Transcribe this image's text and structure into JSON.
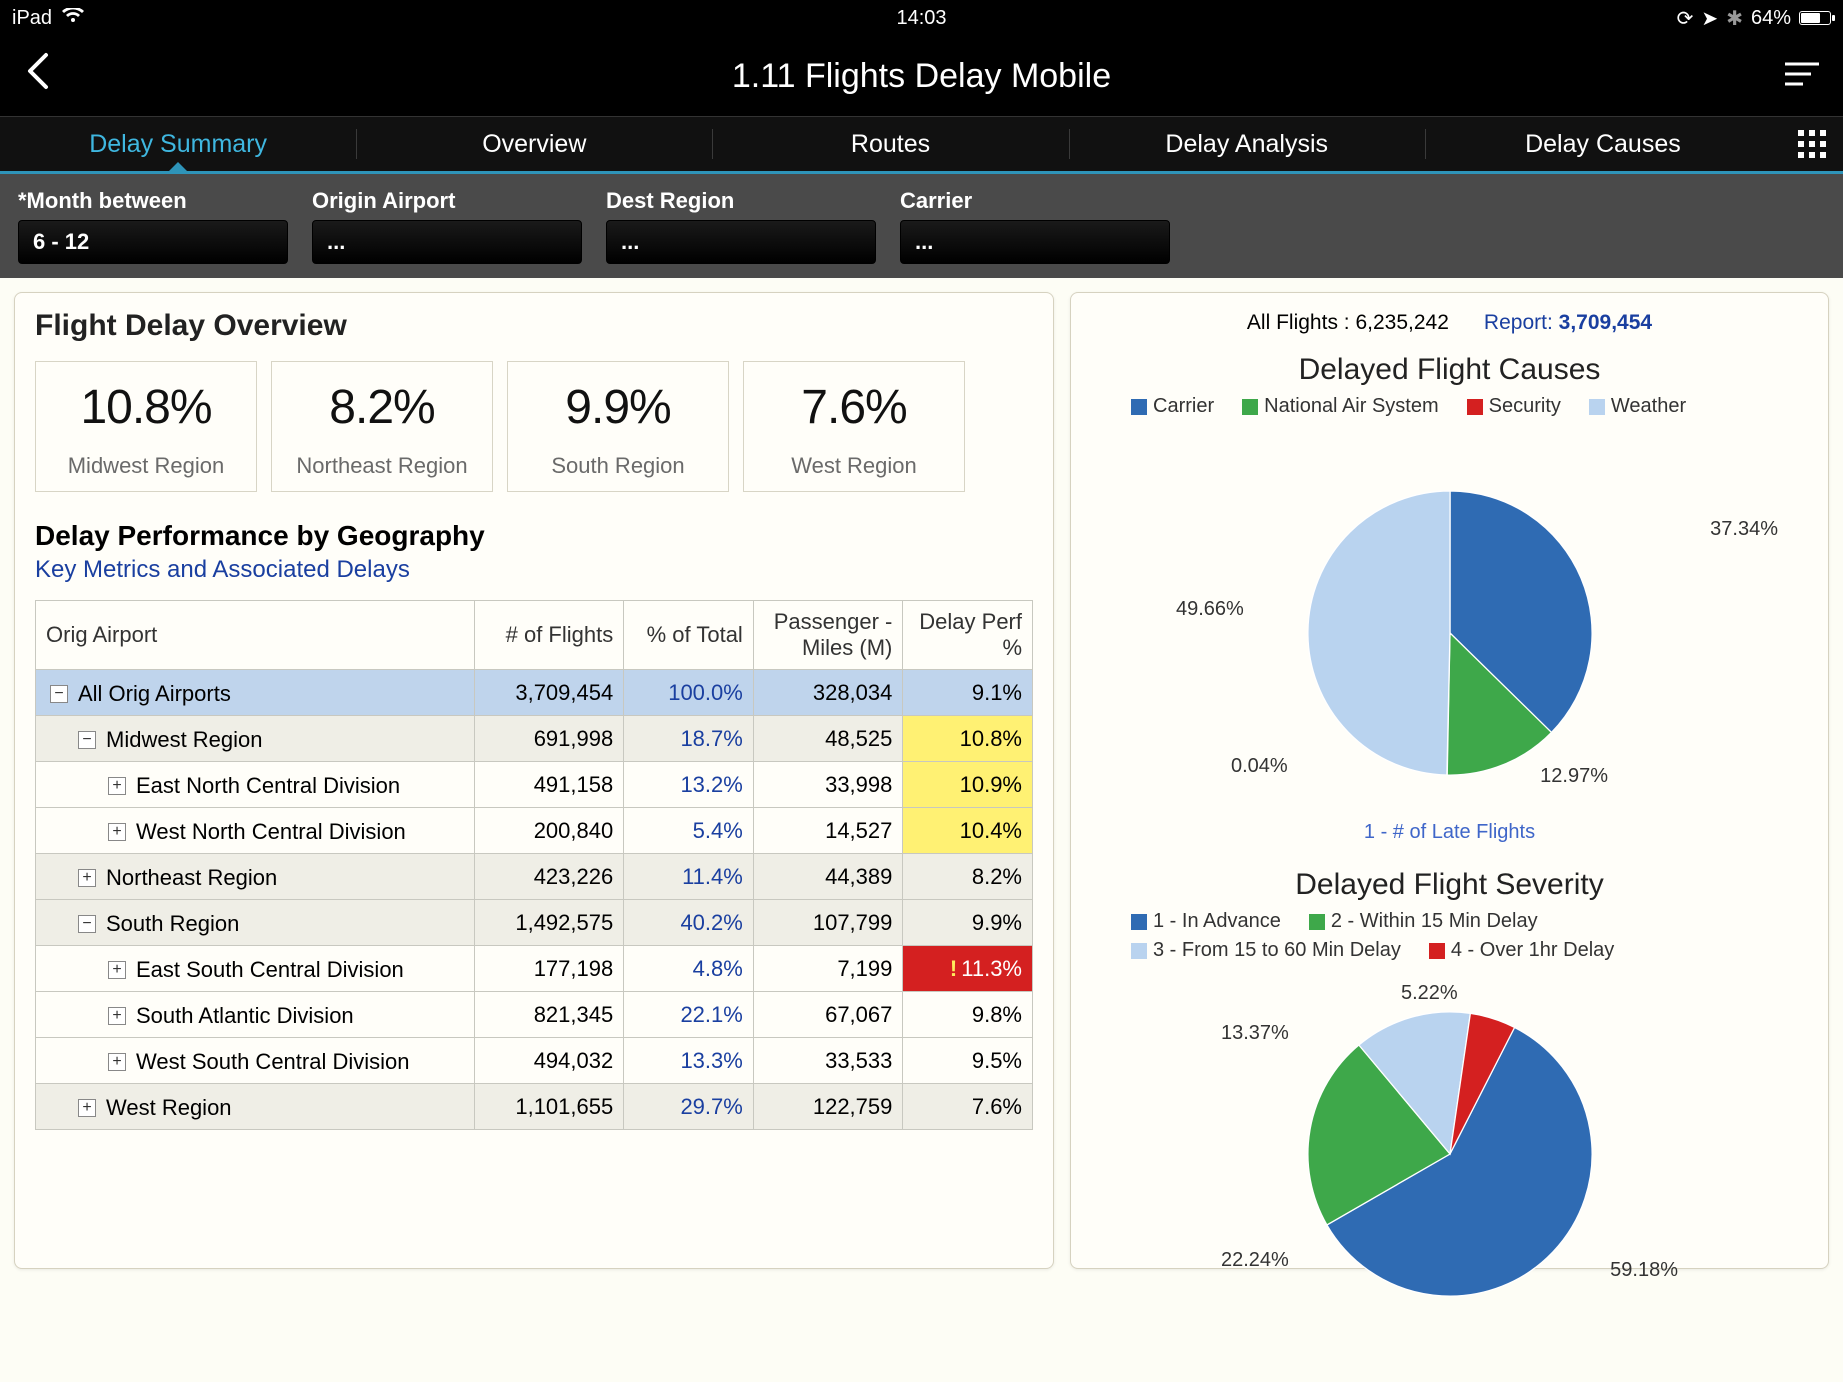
{
  "status": {
    "device": "iPad",
    "time": "14:03",
    "battery": "64%"
  },
  "nav": {
    "title": "1.11 Flights Delay Mobile"
  },
  "tabs": [
    "Delay Summary",
    "Overview",
    "Routes",
    "Delay Analysis",
    "Delay Causes"
  ],
  "active_tab": 0,
  "filters": [
    {
      "label": "*Month between",
      "value": "6 - 12"
    },
    {
      "label": "Origin Airport",
      "value": "..."
    },
    {
      "label": "Dest Region",
      "value": "..."
    },
    {
      "label": "Carrier",
      "value": "..."
    }
  ],
  "overview": {
    "title": "Flight Delay Overview",
    "kpis": [
      {
        "value": "10.8%",
        "label": "Midwest Region"
      },
      {
        "value": "8.2%",
        "label": "Northeast Region"
      },
      {
        "value": "9.9%",
        "label": "South Region"
      },
      {
        "value": "7.6%",
        "label": "West Region"
      }
    ]
  },
  "geo": {
    "title": "Delay Performance by Geography",
    "subtitle": "Key Metrics and Associated Delays",
    "headers": [
      "Orig Airport",
      "# of Flights",
      "% of Total",
      "Passenger - Miles (M)",
      "Delay Perf %"
    ],
    "rows": [
      {
        "lvl": 0,
        "exp": "minus",
        "name": "All Orig Airports",
        "flights": "3,709,454",
        "pct": "100.0%",
        "pm": "328,034",
        "perf": "9.1%",
        "hl": ""
      },
      {
        "lvl": 1,
        "exp": "minus",
        "name": "Midwest Region",
        "flights": "691,998",
        "pct": "18.7%",
        "pm": "48,525",
        "perf": "10.8%",
        "hl": "yellow"
      },
      {
        "lvl": 2,
        "exp": "plus",
        "name": "East North Central Division",
        "flights": "491,158",
        "pct": "13.2%",
        "pm": "33,998",
        "perf": "10.9%",
        "hl": "yellow"
      },
      {
        "lvl": 2,
        "exp": "plus",
        "name": "West North Central Division",
        "flights": "200,840",
        "pct": "5.4%",
        "pm": "14,527",
        "perf": "10.4%",
        "hl": "yellow"
      },
      {
        "lvl": 1,
        "exp": "plus",
        "name": "Northeast Region",
        "flights": "423,226",
        "pct": "11.4%",
        "pm": "44,389",
        "perf": "8.2%",
        "hl": ""
      },
      {
        "lvl": 1,
        "exp": "minus",
        "name": "South Region",
        "flights": "1,492,575",
        "pct": "40.2%",
        "pm": "107,799",
        "perf": "9.9%",
        "hl": ""
      },
      {
        "lvl": 2,
        "exp": "plus",
        "name": "East South Central Division",
        "flights": "177,198",
        "pct": "4.8%",
        "pm": "7,199",
        "perf": "11.3%",
        "hl": "red"
      },
      {
        "lvl": 2,
        "exp": "plus",
        "name": "South Atlantic Division",
        "flights": "821,345",
        "pct": "22.1%",
        "pm": "67,067",
        "perf": "9.8%",
        "hl": ""
      },
      {
        "lvl": 2,
        "exp": "plus",
        "name": "West South Central Division",
        "flights": "494,032",
        "pct": "13.3%",
        "pm": "33,533",
        "perf": "9.5%",
        "hl": ""
      },
      {
        "lvl": 1,
        "exp": "plus",
        "name": "West Region",
        "flights": "1,101,655",
        "pct": "29.7%",
        "pm": "122,759",
        "perf": "7.6%",
        "hl": ""
      }
    ]
  },
  "right": {
    "all_flights_label": "All Flights :",
    "all_flights": "6,235,242",
    "report_label": "Report:",
    "report": "3,709,454"
  },
  "chart_data": [
    {
      "type": "pie",
      "title": "Delayed Flight Causes",
      "axis_label": "1 - # of Late Flights",
      "series": [
        {
          "name": "Carrier",
          "value": 37.34,
          "color": "#2f6bb3"
        },
        {
          "name": "National Air System",
          "value": 12.97,
          "color": "#3ea84a"
        },
        {
          "name": "Security",
          "value": 0.04,
          "color": "#d42020"
        },
        {
          "name": "Weather",
          "value": 49.66,
          "color": "#b9d3ef"
        }
      ]
    },
    {
      "type": "pie",
      "title": "Delayed Flight Severity",
      "series": [
        {
          "name": "1 - In Advance",
          "value": 59.18,
          "color": "#2f6bb3"
        },
        {
          "name": "2 - Within 15 Min Delay",
          "value": 22.24,
          "color": "#3ea84a"
        },
        {
          "name": "3 - From 15 to 60 Min Delay",
          "value": 13.37,
          "color": "#b9d3ef"
        },
        {
          "name": "4 - Over 1hr Delay",
          "value": 5.22,
          "color": "#d42020"
        }
      ]
    }
  ]
}
